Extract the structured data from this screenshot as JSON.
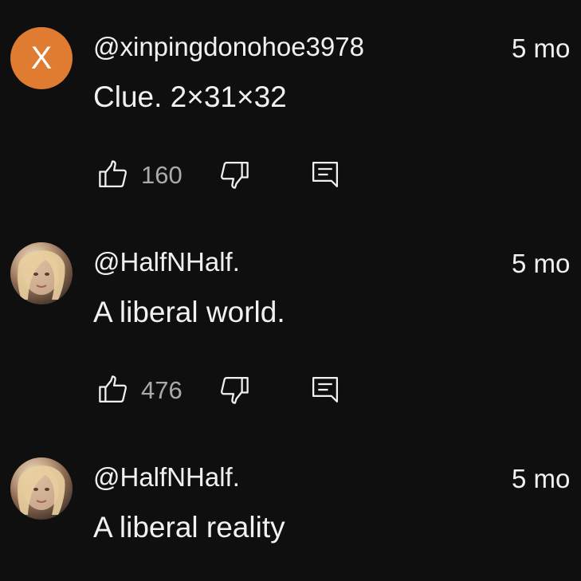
{
  "comments": [
    {
      "author": "@xinpingdonohoe3978",
      "avatar_letter": "X",
      "avatar_color": "#e07b32",
      "time": "5 mo",
      "text": "Clue. 2×31×32",
      "likes": "160"
    },
    {
      "author": "@HalfNHalf.",
      "time": "5 mo",
      "text": "A liberal world.",
      "likes": "476"
    },
    {
      "author": "@HalfNHalf.",
      "time": "5 mo",
      "text": "A liberal reality"
    }
  ],
  "icons": {
    "like": "thumbs-up-icon",
    "dislike": "thumbs-down-icon",
    "reply": "reply-icon"
  }
}
